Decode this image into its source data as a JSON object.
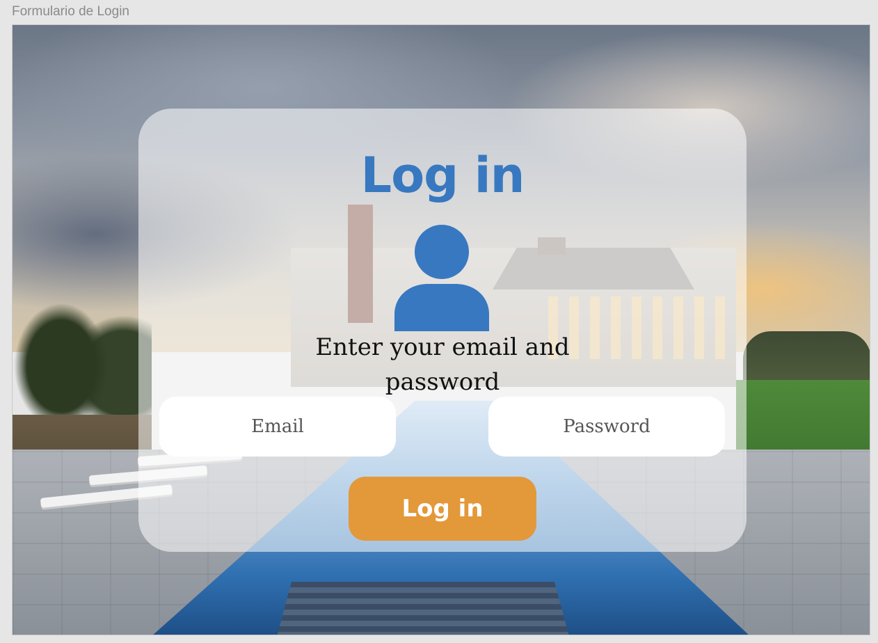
{
  "window": {
    "frame_title": "Formulario de Login"
  },
  "login": {
    "title": "Log in",
    "subtitle": "Enter your email and password",
    "email_placeholder": "Email",
    "password_placeholder": "Password",
    "submit_label": "Log in",
    "user_icon": "user-icon"
  },
  "colors": {
    "title": "#3878c0",
    "icon": "#3878c0",
    "button": "#e3983a",
    "button_text": "#ffffff"
  }
}
